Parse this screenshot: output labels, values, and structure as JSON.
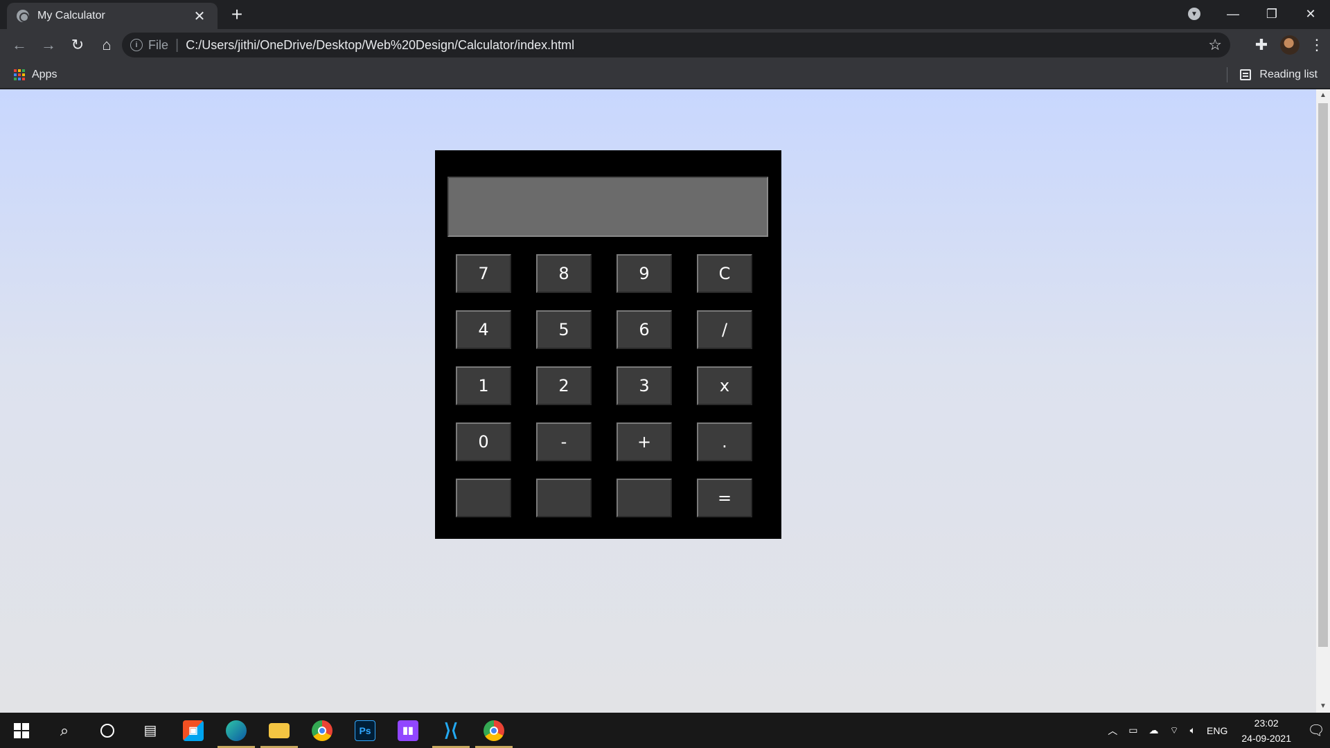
{
  "browser": {
    "tab": {
      "title": "My Calculator"
    },
    "omnibox": {
      "scheme": "File",
      "url": "C:/Users/jithi/OneDrive/Desktop/Web%20Design/Calculator/index.html"
    },
    "bookmarks": {
      "apps_label": "Apps",
      "reading_list_label": "Reading list"
    }
  },
  "calculator": {
    "display_value": "",
    "keys": [
      "7",
      "8",
      "9",
      "C",
      "4",
      "5",
      "6",
      "/",
      "1",
      "2",
      "3",
      "x",
      "0",
      "-",
      "+",
      ".",
      "",
      "",
      "",
      "="
    ]
  },
  "taskbar": {
    "language": "ENG",
    "time": "23:02",
    "date": "24-09-2021"
  },
  "colors": {
    "page_gradient_top": "#c8d7fe",
    "page_gradient_bottom": "#e2e3e6",
    "calculator_body": "#000000",
    "display_bg": "#6b6b6b",
    "key_bg": "#3c3c3c"
  }
}
